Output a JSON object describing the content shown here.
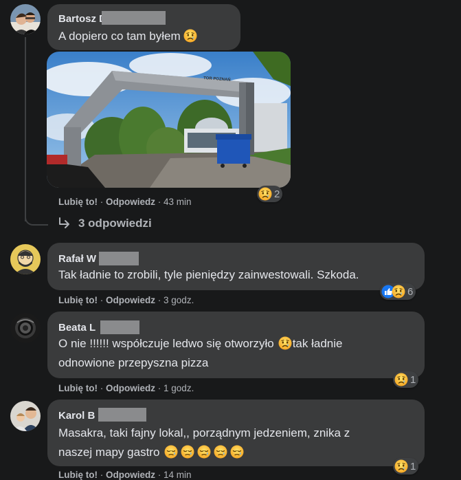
{
  "comments": [
    {
      "author": "Bartosz D",
      "text": "A dopiero co tam byłem",
      "like": "Lubię to!",
      "reply": "Odpowiedz",
      "time": "43 min",
      "reaction_count": "2",
      "replies_label": "3 odpowiedzi",
      "photo_sign": "TOR POZNAŃ"
    },
    {
      "author": "Rafał W",
      "text": "Tak ładnie to zrobili, tyle pieniędzy zainwestowali. Szkoda.",
      "like": "Lubię to!",
      "reply": "Odpowiedz",
      "time": "3 godz.",
      "reaction_count": "6"
    },
    {
      "author": "Beata L",
      "text_line1_a": "O nie !!!!!! współczuje ledwo się otworzyło",
      "text_line1_b": "tak ładnie",
      "text_line2": "odnowione przepyszna pizza",
      "like": "Lubię to!",
      "reply": "Odpowiedz",
      "time": "1 godz.",
      "reaction_count": "1"
    },
    {
      "author": "Karol B",
      "text_line1": "Masakra, taki fajny lokal,, porządnym jedzeniem, znika z",
      "text_line2": "naszej mapy gastro",
      "like": "Lubię to!",
      "reply": "Odpowiedz",
      "time": "14 min",
      "reaction_count": "1"
    }
  ],
  "colors": {
    "background": "#18191a",
    "bubble": "#3a3b3c",
    "secondary_text": "#b0b3b8",
    "like_blue": "#1877f2"
  },
  "icons": [
    "sad-emoji-icon",
    "crying-emoji-icon",
    "sleepy-emoji-icon",
    "like-reaction-icon",
    "reply-arrow-icon"
  ]
}
